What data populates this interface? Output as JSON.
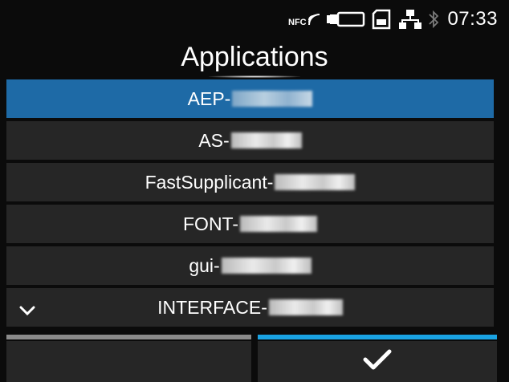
{
  "status_bar": {
    "nfc_label": "NFC",
    "time": "07:33",
    "icons": [
      "nfc-icon",
      "battery-icon",
      "sd-card-icon",
      "network-icon",
      "bluetooth-icon"
    ]
  },
  "screen": {
    "title": "Applications"
  },
  "list": {
    "items": [
      {
        "label": "AEP-",
        "selected": true
      },
      {
        "label": "AS-",
        "selected": false
      },
      {
        "label": "FastSupplicant-",
        "selected": false
      },
      {
        "label": "FONT-",
        "selected": false
      },
      {
        "label": "gui-",
        "selected": false
      },
      {
        "label": "INTERFACE-",
        "selected": false
      }
    ]
  },
  "scroll_indicator": "chevron-down-icon",
  "softkeys": {
    "left": {
      "active": false,
      "color": "#8a8a8a"
    },
    "right": {
      "icon": "checkmark-icon",
      "active": true,
      "color": "#1aa3e3"
    }
  },
  "colors": {
    "background": "#0b0b0b",
    "item": "#262626",
    "selected": "#1e6aa6",
    "accent": "#1aa3e3"
  }
}
